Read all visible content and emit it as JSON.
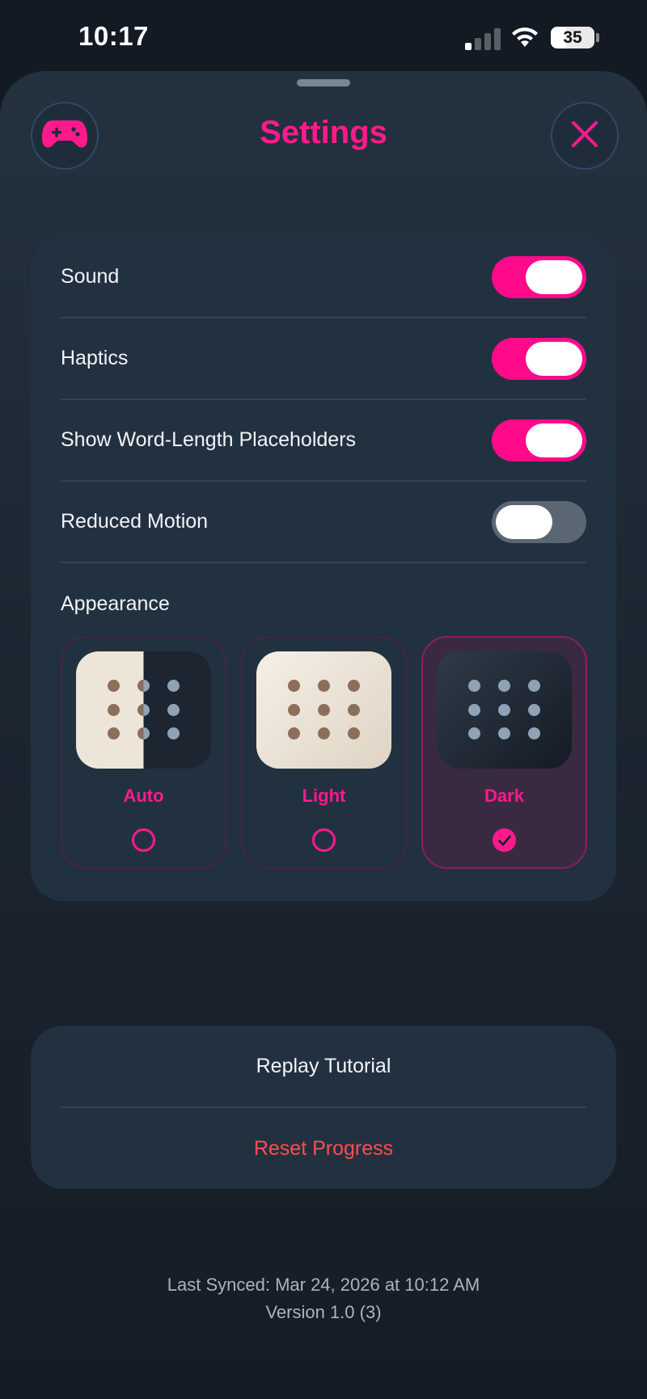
{
  "status_bar": {
    "time": "10:17",
    "battery": "35",
    "signal_bars_active": 1,
    "signal_bars_total": 4
  },
  "header": {
    "title": "Settings",
    "left_icon": "gamepad-icon",
    "right_icon": "close-icon"
  },
  "settings": {
    "toggles": [
      {
        "label": "Sound",
        "on": true
      },
      {
        "label": "Haptics",
        "on": true
      },
      {
        "label": "Show Word-Length Placeholders",
        "on": true
      },
      {
        "label": "Reduced Motion",
        "on": false
      }
    ],
    "appearance": {
      "title": "Appearance",
      "options": [
        {
          "label": "Auto",
          "selected": false
        },
        {
          "label": "Light",
          "selected": false
        },
        {
          "label": "Dark",
          "selected": true
        }
      ]
    }
  },
  "actions": {
    "replay_label": "Replay Tutorial",
    "reset_label": "Reset Progress"
  },
  "footer": {
    "last_synced": "Last Synced: Mar 24, 2026 at 10:12 AM",
    "version": "Version 1.0 (3)"
  },
  "colors": {
    "accent": "#ff1a8c",
    "destructive": "#ff4d4d",
    "card": "#223140",
    "background": "#131a23"
  }
}
